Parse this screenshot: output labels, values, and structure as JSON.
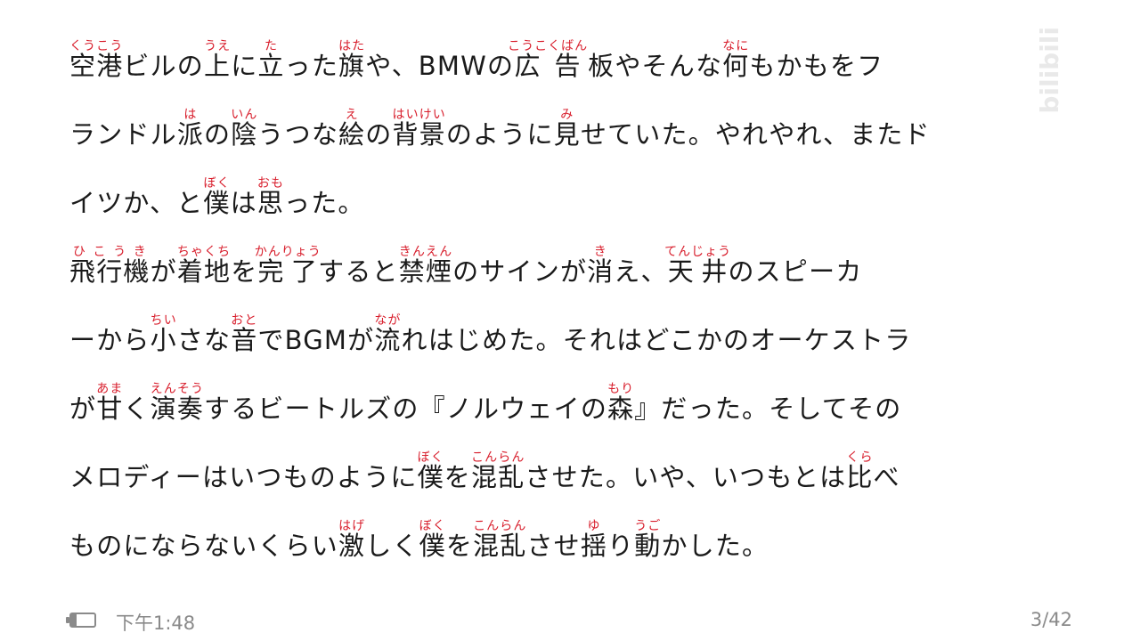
{
  "watermark": "bilibili",
  "status": {
    "time": "下午1:48",
    "page": "3/42"
  },
  "lines": [
    [
      [
        "",
        "空港",
        "くうこう"
      ],
      [
        "ビルの",
        "",
        ""
      ],
      [
        "",
        "上",
        "うえ"
      ],
      [
        "に",
        "",
        ""
      ],
      [
        "",
        "立",
        "た"
      ],
      [
        "った",
        "",
        ""
      ],
      [
        "",
        "旗",
        "はた"
      ],
      [
        "や、BMWの",
        "",
        ""
      ],
      [
        "",
        "広告",
        "こうこくばん"
      ],
      [
        "",
        "板",
        ""
      ],
      [
        "やそんな",
        "",
        ""
      ],
      [
        "",
        "何",
        "なに"
      ],
      [
        "もかもをフ",
        "",
        ""
      ]
    ],
    [
      [
        "ランドル",
        "",
        ""
      ],
      [
        "",
        "派",
        "は"
      ],
      [
        "の",
        "",
        ""
      ],
      [
        "",
        "陰",
        "いん"
      ],
      [
        "うつな",
        "",
        ""
      ],
      [
        "",
        "絵",
        "え"
      ],
      [
        "の",
        "",
        ""
      ],
      [
        "",
        "背景",
        "はいけい"
      ],
      [
        "のように",
        "",
        ""
      ],
      [
        "",
        "見",
        "み"
      ],
      [
        "せていた。やれやれ、またド",
        "",
        ""
      ]
    ],
    [
      [
        "イツか、と",
        "",
        ""
      ],
      [
        "",
        "僕",
        "ぼく"
      ],
      [
        "は",
        "",
        ""
      ],
      [
        "",
        "思",
        "おも"
      ],
      [
        "った。",
        "",
        ""
      ]
    ],
    [
      [
        "",
        "飛行機",
        "ひこうき"
      ],
      [
        "が",
        "",
        ""
      ],
      [
        "",
        "着地",
        "ちゃくち"
      ],
      [
        "を",
        "",
        ""
      ],
      [
        "",
        "完了",
        "かんりょう"
      ],
      [
        "すると",
        "",
        ""
      ],
      [
        "",
        "禁煙",
        "きんえん"
      ],
      [
        "のサインが",
        "",
        ""
      ],
      [
        "",
        "消",
        "き"
      ],
      [
        "え、",
        "",
        ""
      ],
      [
        "",
        "天井",
        "てんじょう"
      ],
      [
        "のスピーカ",
        "",
        ""
      ]
    ],
    [
      [
        "ーから",
        "",
        ""
      ],
      [
        "",
        "小",
        "ちい"
      ],
      [
        "さな",
        "",
        ""
      ],
      [
        "",
        "音",
        "おと"
      ],
      [
        "でBGMが",
        "",
        ""
      ],
      [
        "",
        "流",
        "なが"
      ],
      [
        "れはじめた。それはどこかのオーケストラ",
        "",
        ""
      ]
    ],
    [
      [
        "が",
        "",
        ""
      ],
      [
        "",
        "甘",
        "あま"
      ],
      [
        "く",
        "",
        ""
      ],
      [
        "",
        "演奏",
        "えんそう"
      ],
      [
        "するビートルズの『ノルウェイの",
        "",
        ""
      ],
      [
        "",
        "森",
        "もり"
      ],
      [
        "』だった。そしてその",
        "",
        ""
      ]
    ],
    [
      [
        "メロディーはいつものように",
        "",
        ""
      ],
      [
        "",
        "僕",
        "ぼく"
      ],
      [
        "を",
        "",
        ""
      ],
      [
        "",
        "混乱",
        "こんらん"
      ],
      [
        "させた。いや、いつもとは",
        "",
        ""
      ],
      [
        "",
        "比",
        "くら"
      ],
      [
        "べ",
        "",
        ""
      ]
    ],
    [
      [
        "ものにならないくらい",
        "",
        ""
      ],
      [
        "",
        "激",
        "はげ"
      ],
      [
        "しく",
        "",
        ""
      ],
      [
        "",
        "僕",
        "ぼく"
      ],
      [
        "を",
        "",
        ""
      ],
      [
        "",
        "混乱",
        "こんらん"
      ],
      [
        "させ",
        "",
        ""
      ],
      [
        "",
        "揺",
        "ゆ"
      ],
      [
        "り",
        "",
        ""
      ],
      [
        "",
        "動",
        "うご"
      ],
      [
        "かした。",
        "",
        ""
      ]
    ]
  ]
}
